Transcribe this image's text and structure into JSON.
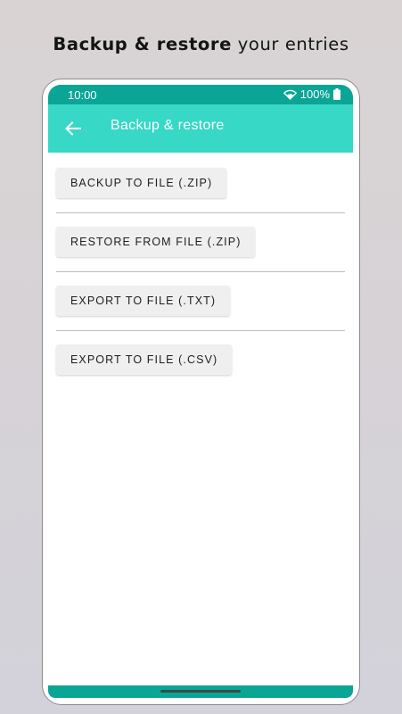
{
  "headline": {
    "bold": "Backup & restore",
    "rest": "your entries"
  },
  "statusbar": {
    "time": "10:00",
    "battery": "100%",
    "icons": [
      "wifi-icon",
      "battery-icon"
    ]
  },
  "appbar": {
    "title": "Backup & restore",
    "back_icon": "arrow-left-icon"
  },
  "actions": [
    {
      "label": "BACKUP TO FILE (.ZIP)"
    },
    {
      "label": "RESTORE FROM FILE (.ZIP)"
    },
    {
      "label": "EXPORT TO FILE (.TXT)"
    },
    {
      "label": "EXPORT TO FILE (.CSV)"
    }
  ],
  "colors": {
    "status_bar": "#0ba596",
    "app_bar": "#37d8c5",
    "button_bg": "#efefef",
    "nav_bar": "#0ba596"
  }
}
